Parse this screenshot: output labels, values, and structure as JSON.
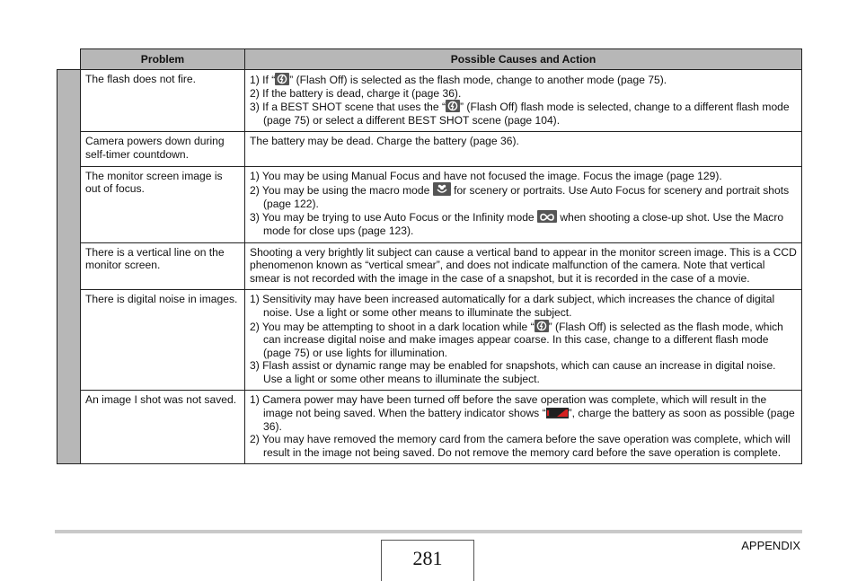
{
  "table": {
    "headers": {
      "problem": "Problem",
      "action": "Possible Causes and Action"
    },
    "rows": [
      {
        "problem": "The flash does not fire.",
        "items": [
          {
            "n": "1) ",
            "a": "If “",
            "icon": "flash-off",
            "b": "” (Flash Off) is selected as the flash mode, change to another mode (page 75)."
          },
          {
            "n": "2) ",
            "a": "If the battery is dead, charge it (page 36)."
          },
          {
            "n": "3) ",
            "a": "If a BEST SHOT scene that uses the “",
            "icon": "flash-off",
            "b": "” (Flash Off) flash mode is selected, change to a different flash mode (page 75) or select a different BEST SHOT scene (page 104)."
          }
        ]
      },
      {
        "problem": "Camera powers down during self-timer countdown.",
        "text": "The battery may be dead. Charge the battery (page 36)."
      },
      {
        "problem": "The monitor screen image is out of focus.",
        "items": [
          {
            "n": "1) ",
            "a": "You may be using Manual Focus and have not focused the image. Focus the image (page 129)."
          },
          {
            "n": "2) ",
            "a": "You may be using the macro mode ",
            "icon": "macro",
            "b": " for scenery or portraits. Use Auto Focus for scenery and portrait shots (page 122)."
          },
          {
            "n": "3) ",
            "a": "You may be trying to use Auto Focus or the Infinity mode ",
            "icon": "infinity",
            "b": " when shooting a close-up shot. Use the Macro mode for close ups (page 123)."
          }
        ]
      },
      {
        "problem": "There is a vertical line on the monitor screen.",
        "text": "Shooting a very brightly lit subject can cause a vertical band to appear in the monitor screen image. This is a CCD phenomenon known as “vertical smear”, and does not indicate malfunction of the camera. Note that vertical smear is not recorded with the image in the case of a snapshot, but it is recorded in the case of a movie."
      },
      {
        "problem": "There is digital noise in images.",
        "items": [
          {
            "n": "1) ",
            "a": "Sensitivity may have been increased automatically for a dark subject, which increases the chance of digital noise. Use a light or some other means to illuminate the subject."
          },
          {
            "n": "2) ",
            "a": "You may be attempting to shoot in a dark location while “",
            "icon": "flash-off",
            "b": "” (Flash Off) is selected as the flash mode, which can increase digital noise and make images appear coarse. In this case, change to a different flash mode (page 75) or use lights for illumination."
          },
          {
            "n": "3) ",
            "a": "Flash assist or dynamic range may be enabled for snapshots, which can cause an increase in digital noise. Use a light or some other means to illuminate the subject."
          }
        ]
      },
      {
        "problem": "An image I shot was not saved.",
        "items": [
          {
            "n": "1) ",
            "a": "Camera power may have been turned off before the save operation was complete, which will result in the image not being saved. When the battery indicator shows “",
            "icon": "battery-low",
            "b": "”, charge the battery as soon as possible (page 36)."
          },
          {
            "n": "2) ",
            "a": "You may have removed the memory card from the camera before the save operation was complete, which will result in the image not being saved. Do not remove the memory card before the save operation is complete."
          }
        ]
      }
    ]
  },
  "footer": {
    "page_number": "281",
    "section": "APPENDIX"
  },
  "colors": {
    "header_bg": "#b7b7b7",
    "side_tab": "#b7b7b7",
    "battery_red": "#d42020",
    "icon_bg": "#555555"
  }
}
